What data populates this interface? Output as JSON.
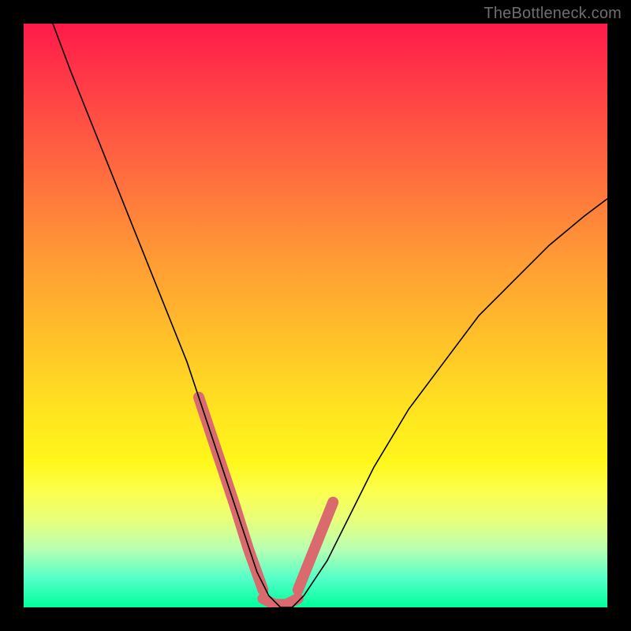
{
  "watermark": "TheBottleneck.com",
  "chart_data": {
    "type": "line",
    "title": "",
    "xlabel": "",
    "ylabel": "",
    "xlim": [
      0,
      100
    ],
    "ylim": [
      0,
      100
    ],
    "grid": false,
    "legend": false,
    "series": [
      {
        "name": "curve",
        "x": [
          5,
          8,
          12,
          16,
          20,
          24,
          28,
          32,
          34,
          36,
          38,
          40,
          42,
          44,
          46,
          48,
          52,
          56,
          60,
          66,
          72,
          78,
          84,
          90,
          96,
          100
        ],
        "y": [
          100,
          92,
          82,
          72,
          62,
          52,
          42,
          30,
          24,
          18,
          12,
          6,
          2,
          0,
          0,
          2,
          8,
          16,
          24,
          34,
          42,
          50,
          56,
          62,
          67,
          70
        ]
      }
    ],
    "highlight_bands": [
      {
        "x": [
          30,
          33,
          36,
          38.5,
          41
        ],
        "y": [
          36,
          27,
          18,
          10,
          3
        ]
      },
      {
        "x": [
          41,
          43,
          45,
          47
        ],
        "y": [
          1.5,
          0.5,
          0.5,
          1.5
        ]
      },
      {
        "x": [
          47,
          49,
          51,
          53
        ],
        "y": [
          3,
          8,
          13,
          18
        ]
      }
    ],
    "colors": {
      "curve": "#000000",
      "highlight": "#d96b6f"
    }
  }
}
